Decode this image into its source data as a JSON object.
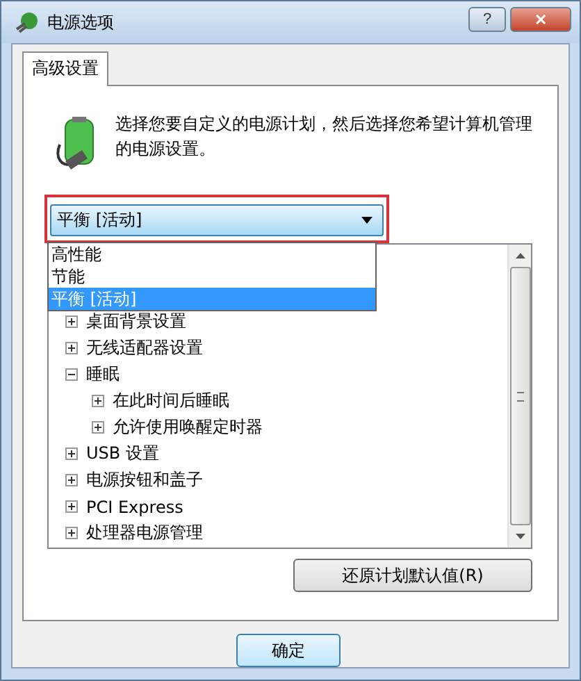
{
  "window": {
    "title": "电源选项",
    "buttons": [
      {
        "kind": "help",
        "label": "?"
      },
      {
        "kind": "close",
        "label": "✕"
      }
    ]
  },
  "tabs": [
    {
      "label": "高级设置",
      "selected": true
    }
  ],
  "description": "选择您要自定义的电源计划，然后选择您希望计算机管理的电源设置。",
  "plan_dropdown": {
    "value": "平衡 [活动]",
    "expanded": true,
    "options": [
      {
        "label": "高性能",
        "selected": false
      },
      {
        "label": "节能",
        "selected": false
      },
      {
        "label": "平衡 [活动]",
        "selected": true
      }
    ]
  },
  "settings_tree": [
    {
      "label": "桌面背景设置",
      "expanded": false
    },
    {
      "label": "无线适配器设置",
      "expanded": false
    },
    {
      "label": "睡眠",
      "expanded": true,
      "children": [
        {
          "label": "在此时间后睡眠",
          "expanded": false
        },
        {
          "label": "允许使用唤醒定时器",
          "expanded": false
        }
      ]
    },
    {
      "label": "USB 设置",
      "expanded": false
    },
    {
      "label": "电源按钮和盖子",
      "expanded": false
    },
    {
      "label": "PCI Express",
      "expanded": false
    },
    {
      "label": "处理器电源管理",
      "expanded": false
    }
  ],
  "restore_button": "还原计划默认值(R)",
  "dialog_buttons": [
    "确定"
  ]
}
